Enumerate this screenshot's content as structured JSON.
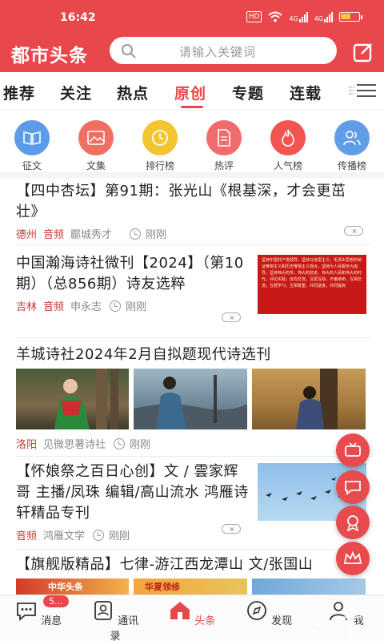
{
  "status": {
    "time": "16:42",
    "hd": "HD",
    "signal1": "4G",
    "signal2": "4G"
  },
  "header": {
    "brand": "都市头条",
    "search_placeholder": "请输入关键词"
  },
  "tabs": [
    "推荐",
    "关注",
    "热点",
    "原创",
    "专题",
    "连载",
    "≡"
  ],
  "active_tab": "原创",
  "categories": [
    {
      "label": "征文",
      "icon": "book-icon",
      "color": "#5b9bea"
    },
    {
      "label": "文集",
      "icon": "picture-icon",
      "color": "#ef6f62"
    },
    {
      "label": "排行榜",
      "icon": "clock-icon",
      "color": "#f2c531"
    },
    {
      "label": "热评",
      "icon": "document-icon",
      "color": "#f06b6b"
    },
    {
      "label": "人气榜",
      "icon": "flame-icon",
      "color": "#f2554f"
    },
    {
      "label": "传播榜",
      "icon": "people-icon",
      "color": "#5f9ee6"
    }
  ],
  "articles": [
    {
      "title": "【四中杏坛】第91期：张光山《根基深，才会更茁壮》",
      "location": "德州",
      "audio": "音频",
      "source": "郿城秀才",
      "time": "刚刚"
    },
    {
      "title": "中国瀚海诗社微刊【2024】（第10期）（总856期）诗友选粹",
      "location": "吉林",
      "audio": "音频",
      "source": "申永志",
      "time": "刚刚",
      "thumb_text": "坚持中国共产党领导，坚持马克思主义，毛泽东思想的辩证唯物主义和历史唯物主义观点，坚持为人民服务为指导，坚持伟大的传，伟大的前进，伟大的人民和伟大的时代，评比实践，双向交流，互帮互助，不懈使命，互相交流，互帮学习，互相尊重，共同进度，共同提高"
    },
    {
      "title": "羊城诗社2024年2月自拟题现代诗选刊",
      "location": "洛阳",
      "source": "见微思著诗社",
      "time": "刚刚"
    },
    {
      "title": "【怀娘祭之百日心创】文 / 雲家辉哥 主播/凤珠 编辑/高山流水 鸿雁诗轩精品专刊",
      "audio": "音频",
      "source": "鸿雁文学",
      "time": "刚刚"
    },
    {
      "title": "【旗舰版精品】七律-游江西龙潭山 文/张国山",
      "thumb_text1": "中华头条",
      "thumb_text2": "华夏领修"
    }
  ],
  "bottom_nav": [
    {
      "label": "消息",
      "icon": "message-icon",
      "badge": "5..."
    },
    {
      "label": "通讯录",
      "icon": "contacts-icon"
    },
    {
      "label": "头条",
      "icon": "home-icon"
    },
    {
      "label": "发现",
      "icon": "compass-icon"
    },
    {
      "label": "我",
      "icon": "person-icon"
    }
  ],
  "active_nav": "头条",
  "watermark": "一下载",
  "colors": {
    "brand": "#e8474b",
    "accent_text": "#c63c34"
  }
}
